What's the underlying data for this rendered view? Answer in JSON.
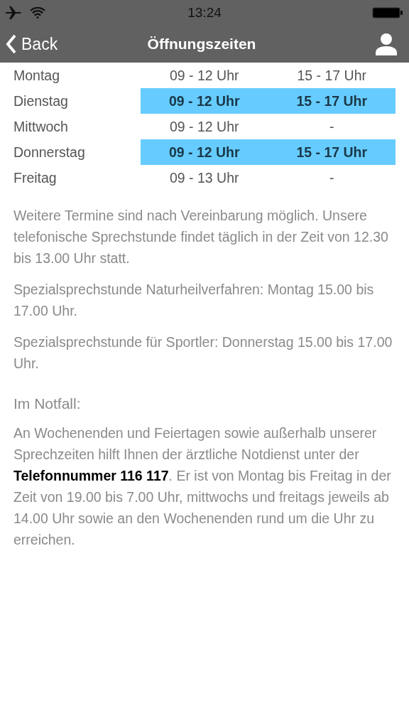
{
  "status_bar": {
    "time": "13:24"
  },
  "nav": {
    "back": "Back",
    "title": "Öffnungszeiten"
  },
  "hours": [
    {
      "day": "Montag",
      "morning": "09 - 12 Uhr",
      "afternoon": "15 - 17 Uhr",
      "selected": false
    },
    {
      "day": "Dienstag",
      "morning": "09 - 12 Uhr",
      "afternoon": "15 - 17 Uhr",
      "selected": true
    },
    {
      "day": "Mittwoch",
      "morning": "09 - 12 Uhr",
      "afternoon": "-",
      "selected": false
    },
    {
      "day": "Donnerstag",
      "morning": "09 - 12 Uhr",
      "afternoon": "15 - 17 Uhr",
      "selected": true
    },
    {
      "day": "Freitag",
      "morning": "09 - 13 Uhr",
      "afternoon": "-",
      "selected": false
    }
  ],
  "notes": [
    "Weitere Termine sind nach Vereinbarung möglich. Unsere telefonische Sprechstunde findet täglich in der Zeit von 12.30 bis 13.00 Uhr statt.",
    "Spezialsprechstunde Naturheilverfahren: Montag 15.00 bis 17.00 Uhr.",
    "Spezialsprechstunde für Sportler: Donnerstag 15.00 bis 17.00 Uhr."
  ],
  "emergency": {
    "heading": "Im Notfall:",
    "text": "An Wochenenden und Feiertagen sowie außerhalb unserer Sprechzeiten hilft Ihnen der ärztliche Notdienst unter der **Telefonnummer 116 117**. Er ist von Montag bis Freitag in der Zeit von 19.00 bis 7.00 Uhr, mittwochs und freitags jeweils ab 14.00 Uhr sowie an den Wochenenden rund um die Uhr zu erreichen."
  }
}
